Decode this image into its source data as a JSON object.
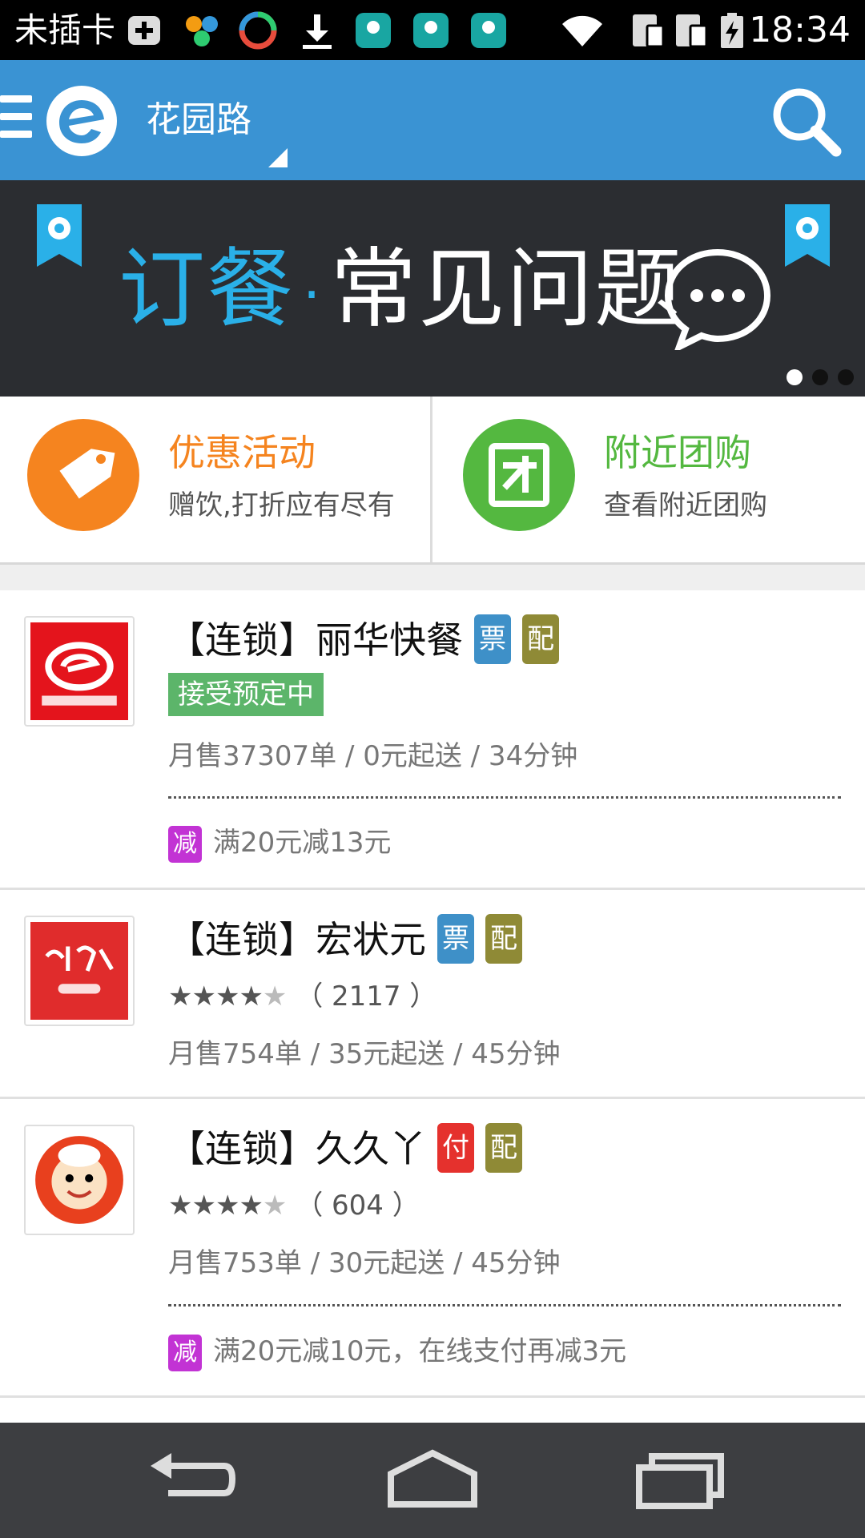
{
  "status_bar": {
    "carrier": "未插卡",
    "time": "18:34",
    "icons": [
      "add-icon",
      "app-icon",
      "app-icon",
      "download-icon",
      "huawei-icon",
      "huawei-icon",
      "huawei-icon",
      "wifi-icon",
      "sim-icon",
      "sim-icon",
      "battery-icon"
    ]
  },
  "app_bar": {
    "location": "花园路",
    "icons": [
      "menu-icon",
      "eleme-logo",
      "search-icon"
    ]
  },
  "banner": {
    "text_a": "订餐",
    "dot": "·",
    "text_b": "常见问题",
    "page_count": 3,
    "active_page": 1
  },
  "promos": [
    {
      "title": "优惠活动",
      "subtitle": "赠饮,打折应有尽有",
      "icon": "tag-icon",
      "color": "#f5841f"
    },
    {
      "title": "附近团购",
      "subtitle": "查看附近团购",
      "icon": "group-buy-icon",
      "color": "#54b840"
    }
  ],
  "restaurants": [
    {
      "name": "【连锁】丽华快餐",
      "tags": [
        {
          "label": "票",
          "color": "#3e90c8"
        },
        {
          "label": "配",
          "color": "#8f8a36"
        }
      ],
      "status": "接受预定中",
      "stats": "月售37307单 / 0元起送 / 34分钟",
      "promo_badge": "减",
      "promo": "满20元减13元"
    },
    {
      "name": "【连锁】宏状元",
      "tags": [
        {
          "label": "票",
          "color": "#3e90c8"
        },
        {
          "label": "配",
          "color": "#8f8a36"
        }
      ],
      "rating": 4.5,
      "reviews": "（ 2117 ）",
      "stats": "月售754单 / 35元起送 / 45分钟"
    },
    {
      "name": "【连锁】久久丫",
      "tags": [
        {
          "label": "付",
          "color": "#e5312d"
        },
        {
          "label": "配",
          "color": "#8f8a36"
        }
      ],
      "rating": 4.5,
      "reviews": "（ 604 ）",
      "stats": "月售753单 / 30元起送 / 45分钟",
      "promo_badge": "减",
      "promo": "满20元减10元，在线支付再减3元"
    }
  ],
  "nav_bar": {
    "icons": [
      "back-icon",
      "home-icon",
      "recents-icon"
    ]
  },
  "colors": {
    "app_bar": "#3a93d3",
    "banner_bg": "#2b2d31",
    "accent_blue": "#2ab0e8"
  }
}
